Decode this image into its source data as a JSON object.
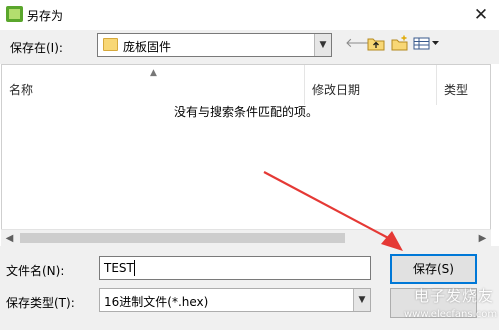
{
  "window": {
    "title": "另存为",
    "close_glyph": "✕"
  },
  "toolbar": {
    "save_in_label": "保存在(I):",
    "save_in_value": "庞板固件",
    "icons": [
      "back-arrow-icon",
      "up-folder-icon",
      "new-folder-icon",
      "view-menu-icon"
    ]
  },
  "list": {
    "columns": [
      "名称",
      "修改日期",
      "类型"
    ],
    "empty_message": "没有与搜索条件匹配的项。"
  },
  "form": {
    "filename_label": "文件名(N):",
    "filename_value": "TEST",
    "filetype_label": "保存类型(T):",
    "filetype_value": "16进制文件(*.hex)",
    "save_button": "保存(S)"
  },
  "watermark": {
    "line1": "电子发烧友",
    "line2": "www.elecfans.com"
  },
  "colors": {
    "arrow": "#e53935",
    "accent": "#0078d7"
  }
}
